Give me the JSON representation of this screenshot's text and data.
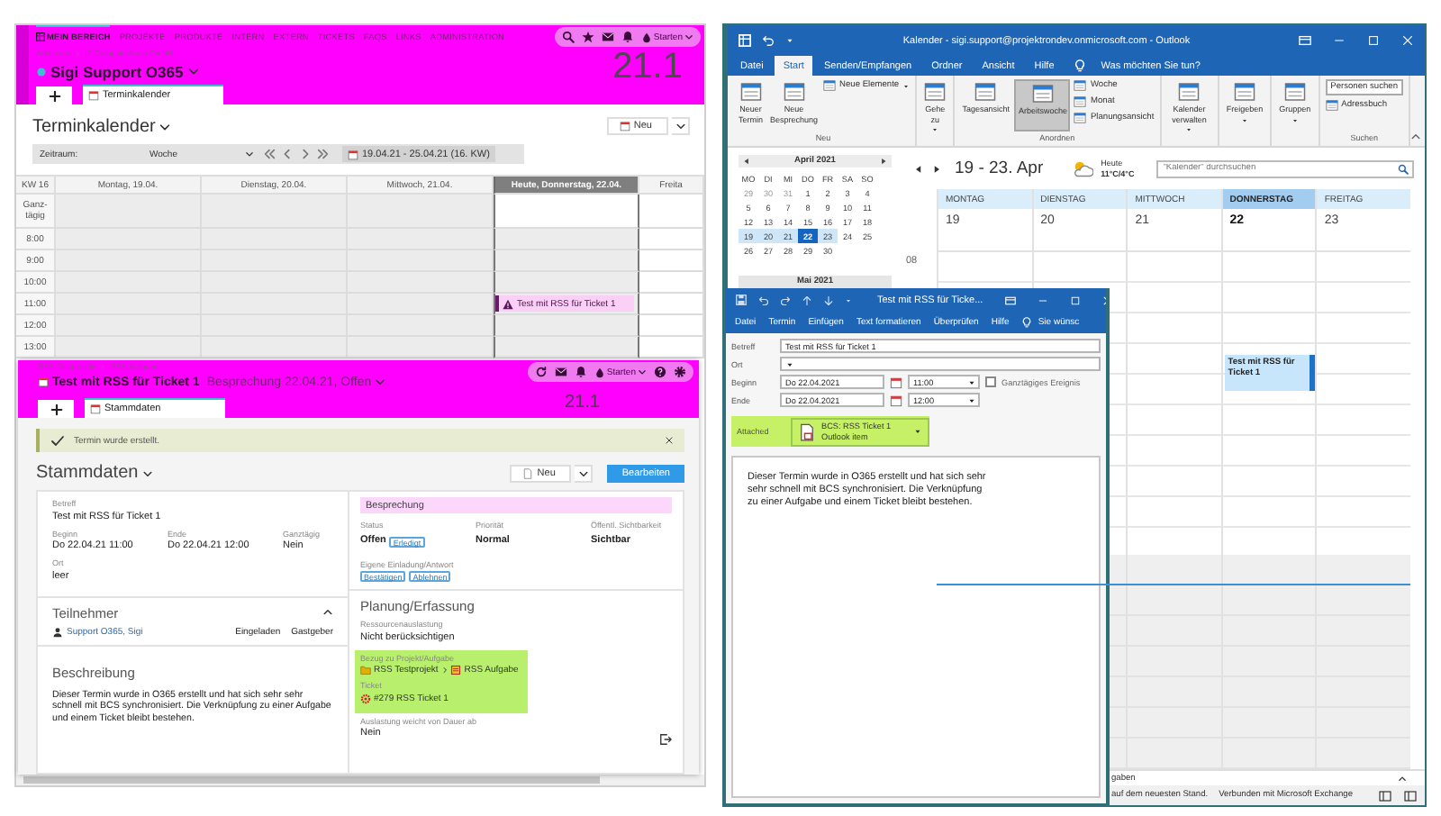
{
  "bcs_window": {
    "nav": [
      {
        "label": "MEIN BEREICH",
        "selected": true
      },
      {
        "label": "PROJEKTE",
        "selected": false
      },
      {
        "label": "PRODUKTE",
        "selected": false
      },
      {
        "label": "INTERN",
        "selected": false
      },
      {
        "label": "EXTERN",
        "selected": false
      },
      {
        "label": "TICKETS",
        "selected": false
      },
      {
        "label": "FAQS",
        "selected": false
      },
      {
        "label": "LINKS",
        "selected": false
      },
      {
        "label": "ADMINISTRATION",
        "selected": false
      }
    ],
    "start_menu": "Starten",
    "breadcrumb": [
      "Adressen",
      "IT-Computerbuch GmbH"
    ],
    "context": "Sigi Support O365",
    "version": "21.1",
    "tabs": [
      {
        "label": "Terminkalender",
        "selected": true
      }
    ],
    "title": "Terminkalender",
    "new_button": "Neu",
    "period_label": "Zeitraum:",
    "period_value": "Woche",
    "range": "19.04.21 - 25.04.21 (16. KW)",
    "week": "KW 16",
    "days": [
      {
        "label": "Montag, 19.04.",
        "today": false
      },
      {
        "label": "Dienstag, 20.04.",
        "today": false
      },
      {
        "label": "Mittwoch, 21.04.",
        "today": false
      },
      {
        "label": "Heute, Donnerstag, 22.04.",
        "today": true
      },
      {
        "label": "Freita",
        "today": false
      }
    ],
    "allday_label": "Ganz-tägig",
    "hours": [
      {
        "label": "8:00",
        "cells": [
          {},
          {},
          {},
          {},
          {}
        ]
      },
      {
        "label": "9:00",
        "cells": [
          {},
          {},
          {},
          {},
          {}
        ]
      },
      {
        "label": "10:00",
        "cells": [
          {},
          {},
          {},
          {},
          {}
        ]
      },
      {
        "label": "11:00",
        "cells": [
          {},
          {},
          {},
          {
            "event": "Test mit RSS für Ticket 1"
          },
          {}
        ]
      },
      {
        "label": "12:00",
        "cells": [
          {},
          {},
          {},
          {},
          {}
        ]
      },
      {
        "label": "13:00",
        "cells": [
          {},
          {},
          {},
          {},
          {}
        ]
      }
    ]
  },
  "ticket_window": {
    "breadcrumb": [
      "RSS Testprojekt",
      "RSS Aufgabe"
    ],
    "title": "Test mit RSS für Ticket 1",
    "subtitle": "Besprechung 22.04.21, Offen",
    "start_menu": "Starten",
    "version": "21.1",
    "tabs": [
      {
        "label": "Stammdaten",
        "selected": true
      }
    ],
    "notice": "Termin wurde erstellt.",
    "section": "Stammdaten",
    "new_button": "Neu",
    "edit_button": "Bearbeiten",
    "subject": {
      "label": "Betreff",
      "value": "Test mit RSS für Ticket 1"
    },
    "time_fields": [
      {
        "label": "Beginn",
        "value": "Do 22.04.21 11:00"
      },
      {
        "label": "Ende",
        "value": "Do 22.04.21 12:00"
      },
      {
        "label": "Ganztägig",
        "value": "Nein"
      }
    ],
    "location": {
      "label": "Ort",
      "value": "leer"
    },
    "participants": {
      "title": "Teilnehmer",
      "rows": [
        {
          "name": "Support O365, Sigi",
          "status": "Eingeladen",
          "role": "Gastgeber"
        }
      ]
    },
    "description": {
      "title": "Beschreibung",
      "text": "Dieser Termin wurde in O365 erstellt und hat sich sehr sehr schnell mit BCS synchronisiert. Die Verknüpfung zu einer Aufgabe und einem Ticket bleibt bestehen."
    },
    "type_header": "Besprechung",
    "status_fields": [
      {
        "label": "Status",
        "value": "Offen",
        "action": "Erledigt"
      },
      {
        "label": "Priorität",
        "value": "Normal"
      },
      {
        "label": "Öffentl. Sichtbarkeit",
        "value": "Sichtbar"
      }
    ],
    "invitation": {
      "label": "Eigene Einladung/Antwort",
      "actions": [
        "Bestätigen",
        "Ablehnen"
      ]
    },
    "planning": {
      "title": "Planung/Erfassung",
      "resource_label": "Ressourcenauslastung",
      "resource_value": "Nicht berücksichtigen",
      "relation_label": "Bezug zu Projekt/Aufgabe",
      "project": "RSS Testprojekt",
      "task": "RSS Aufgabe",
      "ticket_label": "Ticket",
      "ticket": "#279 RSS Ticket 1",
      "deviation_label": "Auslastung weicht von Dauer ab",
      "deviation_value": "Nein"
    }
  },
  "outlook_window": {
    "title": "Kalender - sigi.support@projektrondev.onmicrosoft.com - Outlook",
    "tabs": [
      {
        "label": "Datei",
        "selected": false
      },
      {
        "label": "Start",
        "selected": true
      },
      {
        "label": "Senden/Empfangen",
        "selected": false
      },
      {
        "label": "Ordner",
        "selected": false
      },
      {
        "label": "Ansicht",
        "selected": false
      },
      {
        "label": "Hilfe",
        "selected": false
      }
    ],
    "tell_me": "Was möchten Sie tun?",
    "ribbon": [
      {
        "label": "Neu",
        "items": [
          {
            "label": "Neuer Termin",
            "kind": "large",
            "menu": false,
            "selected": false
          },
          {
            "label": "Neue Besprechung",
            "kind": "large",
            "menu": false,
            "selected": false
          },
          {
            "label": "Neue Elemente",
            "kind": "small",
            "menu": true,
            "selected": false
          }
        ]
      },
      {
        "items": [
          {
            "label": "Gehe zu",
            "kind": "large",
            "menu": true,
            "selected": false
          }
        ]
      },
      {
        "label": "Anordnen",
        "items": [
          {
            "label": "Tagesansicht",
            "kind": "large",
            "menu": false,
            "selected": false
          },
          {
            "label": "Arbeitswoche",
            "kind": "large",
            "menu": false,
            "selected": true
          },
          {
            "label": "Woche",
            "kind": "small",
            "menu": false,
            "selected": false
          },
          {
            "label": "Monat",
            "kind": "small",
            "menu": false,
            "selected": false
          },
          {
            "label": "Planungsansicht",
            "kind": "small",
            "menu": false,
            "selected": false
          }
        ]
      },
      {
        "items": [
          {
            "label": "Kalender verwalten",
            "kind": "large",
            "menu": true,
            "selected": false
          }
        ]
      },
      {
        "items": [
          {
            "label": "Freigeben",
            "kind": "large",
            "menu": true,
            "selected": false
          }
        ]
      },
      {
        "items": [
          {
            "label": "Gruppen",
            "kind": "large",
            "menu": true,
            "selected": false
          }
        ]
      },
      {
        "label": "Suchen",
        "items": [
          {
            "label": "Personen suchen",
            "kind": "field",
            "menu": false,
            "selected": false
          },
          {
            "label": "Adressbuch",
            "kind": "small",
            "menu": false,
            "selected": false
          }
        ]
      }
    ],
    "mini_calendar": {
      "month": "April 2021",
      "weekdays": [
        "MO",
        "DI",
        "MI",
        "DO",
        "FR",
        "SA",
        "SO"
      ],
      "weeks": [
        [
          {
            "d": "29",
            "kind": "outside"
          },
          {
            "d": "30",
            "kind": "outside"
          },
          {
            "d": "31",
            "kind": "outside"
          },
          {
            "d": "1",
            "kind": "normal"
          },
          {
            "d": "2",
            "kind": "normal"
          },
          {
            "d": "3",
            "kind": "normal"
          },
          {
            "d": "4",
            "kind": "normal"
          }
        ],
        [
          {
            "d": "5",
            "kind": "normal"
          },
          {
            "d": "6",
            "kind": "normal"
          },
          {
            "d": "7",
            "kind": "normal"
          },
          {
            "d": "8",
            "kind": "normal"
          },
          {
            "d": "9",
            "kind": "normal"
          },
          {
            "d": "10",
            "kind": "normal"
          },
          {
            "d": "11",
            "kind": "normal"
          }
        ],
        [
          {
            "d": "12",
            "kind": "normal"
          },
          {
            "d": "13",
            "kind": "normal"
          },
          {
            "d": "14",
            "kind": "normal"
          },
          {
            "d": "15",
            "kind": "normal"
          },
          {
            "d": "16",
            "kind": "normal"
          },
          {
            "d": "17",
            "kind": "normal"
          },
          {
            "d": "18",
            "kind": "normal"
          }
        ],
        [
          {
            "d": "19",
            "kind": "selected"
          },
          {
            "d": "20",
            "kind": "selected"
          },
          {
            "d": "21",
            "kind": "selected"
          },
          {
            "d": "22",
            "kind": "today"
          },
          {
            "d": "23",
            "kind": "selected"
          },
          {
            "d": "24",
            "kind": "normal"
          },
          {
            "d": "25",
            "kind": "normal"
          }
        ],
        [
          {
            "d": "26",
            "kind": "normal"
          },
          {
            "d": "27",
            "kind": "normal"
          },
          {
            "d": "28",
            "kind": "normal"
          },
          {
            "d": "29",
            "kind": "normal"
          },
          {
            "d": "30",
            "kind": "normal"
          }
        ]
      ],
      "next_month": "Mai 2021"
    },
    "range_title": "19 - 23. Apr",
    "weather": {
      "label": "Heute",
      "temps": "11°C/4°C"
    },
    "search_placeholder": "\"Kalender\" durchsuchen",
    "days": [
      {
        "name": "MONTAG",
        "date": "19",
        "today": false
      },
      {
        "name": "DIENSTAG",
        "date": "20",
        "today": false
      },
      {
        "name": "MITTWOCH",
        "date": "21",
        "today": false
      },
      {
        "name": "DONNERSTAG",
        "date": "22",
        "today": true,
        "events": [
          "Test mit RSS für Ticket 1"
        ]
      },
      {
        "name": "FREITAG",
        "date": "23",
        "today": false
      }
    ],
    "hours": [
      "08"
    ],
    "tasks_label": "gaben",
    "status": [
      "auf dem neuesten Stand.",
      "Verbunden mit Microsoft Exchange"
    ]
  },
  "appointment_window": {
    "title": "Test mit RSS für Ticke...",
    "tabs": [
      "Datei",
      "Termin",
      "Einfügen",
      "Text formatieren",
      "Überprüfen",
      "Hilfe"
    ],
    "tell_me": "Sie wünsc",
    "subject": {
      "label": "Betreff",
      "value": "Test mit RSS für Ticket 1"
    },
    "location": {
      "label": "Ort"
    },
    "start": {
      "label": "Beginn",
      "date": "Do 22.04.2021",
      "time": "11:00"
    },
    "end": {
      "label": "Ende",
      "date": "Do 22.04.2021",
      "time": "12:00"
    },
    "all_day": {
      "label": "Ganztägiges Ereignis",
      "checked": false
    },
    "attachment": {
      "label": "Attached",
      "name": "BCS: RSS Ticket 1",
      "type": "Outlook item"
    },
    "body": "Dieser Termin wurde in O365 erstellt und hat sich sehr sehr schnell mit BCS synchronisiert. Die Verknüpfung zu einer Aufgabe und einem Ticket bleibt bestehen."
  }
}
